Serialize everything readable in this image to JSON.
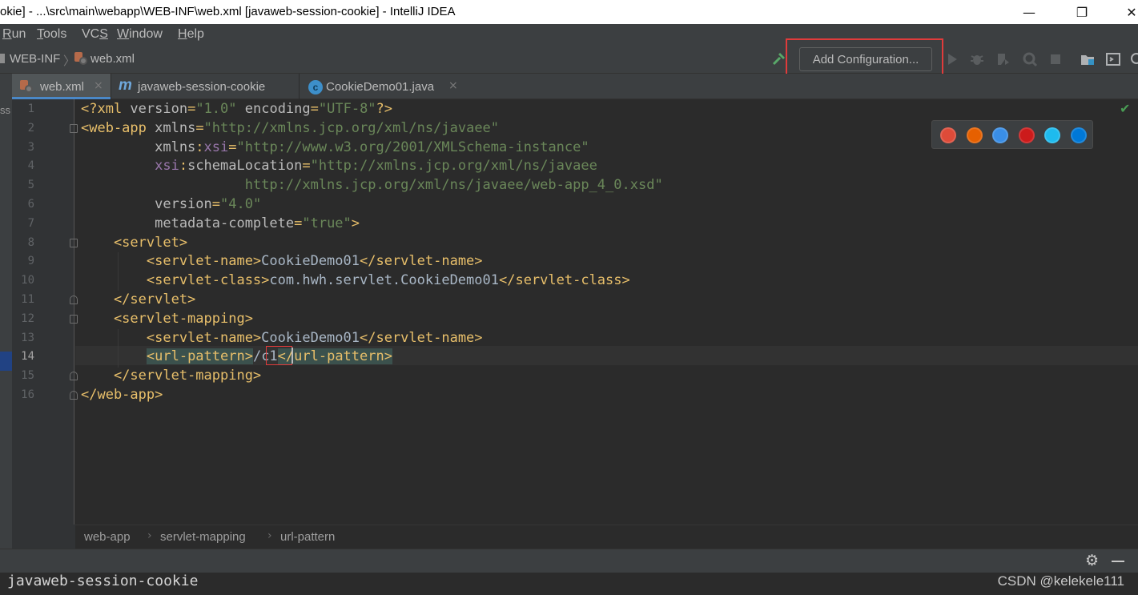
{
  "window": {
    "title": "okie] - ...\\src\\main\\webapp\\WEB-INF\\web.xml [javaweb-session-cookie] - IntelliJ IDEA",
    "minimize": "—",
    "maximize": "❐",
    "close": "✕"
  },
  "menu": {
    "items": [
      {
        "key": "R",
        "rest": "un"
      },
      {
        "key": "T",
        "rest": "ools"
      },
      {
        "key": "",
        "pre": "VC",
        "rest": "S"
      },
      {
        "key": "W",
        "rest": "indow"
      },
      {
        "key": "H",
        "rest": "elp"
      }
    ]
  },
  "nav": {
    "folder": "WEB-INF",
    "file": "web.xml",
    "add_configuration": "Add Configuration..."
  },
  "tabs": [
    {
      "label": "web.xml",
      "active": true,
      "icon": "xml-file-icon"
    },
    {
      "label": "javaweb-session-cookie",
      "active": false,
      "icon": "maven-m-icon"
    },
    {
      "label": "CookieDemo01.java",
      "active": false,
      "icon": "java-class-icon"
    }
  ],
  "tab_close": "×",
  "left_strip_text": "ss",
  "editor": {
    "line_numbers": [
      "1",
      "2",
      "3",
      "4",
      "5",
      "6",
      "7",
      "8",
      "9",
      "10",
      "11",
      "12",
      "13",
      "14",
      "15",
      "16"
    ],
    "current_line": 14,
    "lines": [
      [
        [
          "t-tag",
          "<?xml "
        ],
        [
          "t-attr",
          "version"
        ],
        [
          "t-tag",
          "="
        ],
        [
          "t-val",
          "\"1.0\""
        ],
        [
          "t-attr",
          " encoding"
        ],
        [
          "t-tag",
          "="
        ],
        [
          "t-val",
          "\"UTF-8\""
        ],
        [
          "t-tag",
          "?>"
        ]
      ],
      [
        [
          "t-tag",
          "<web-app "
        ],
        [
          "t-attr",
          "xmlns"
        ],
        [
          "t-tag",
          "="
        ],
        [
          "t-val",
          "\"http://xmlns.jcp.org/xml/ns/javaee\""
        ]
      ],
      [
        [
          "t-attr",
          "         xmlns"
        ],
        [
          "t-tag",
          ":"
        ],
        [
          "t-ns",
          "xsi"
        ],
        [
          "t-tag",
          "="
        ],
        [
          "t-val",
          "\"http://www.w3.org/2001/XMLSchema-instance\""
        ]
      ],
      [
        [
          "t-ns",
          "         xsi"
        ],
        [
          "t-tag",
          ":"
        ],
        [
          "t-attr",
          "schemaLocation"
        ],
        [
          "t-tag",
          "="
        ],
        [
          "t-val",
          "\"http://xmlns.jcp.org/xml/ns/javaee"
        ]
      ],
      [
        [
          "t-val",
          "                    http://xmlns.jcp.org/xml/ns/javaee/web-app_4_0.xsd\""
        ]
      ],
      [
        [
          "t-attr",
          "         version"
        ],
        [
          "t-tag",
          "="
        ],
        [
          "t-val",
          "\"4.0\""
        ]
      ],
      [
        [
          "t-attr",
          "         metadata-complete"
        ],
        [
          "t-tag",
          "="
        ],
        [
          "t-val",
          "\"true\""
        ],
        [
          "t-tag",
          ">"
        ]
      ],
      [
        [
          "t-tag",
          "    <servlet>"
        ]
      ],
      [
        [
          "t-tag",
          "        <servlet-name>"
        ],
        [
          "t-txt",
          "CookieDemo01"
        ],
        [
          "t-tag",
          "</servlet-name>"
        ]
      ],
      [
        [
          "t-tag",
          "        <servlet-class>"
        ],
        [
          "t-txt",
          "com.hwh.servlet.CookieDemo01"
        ],
        [
          "t-tag",
          "</servlet-class>"
        ]
      ],
      [
        [
          "t-tag",
          "    </servlet>"
        ]
      ],
      [
        [
          "t-tag",
          "    <servlet-mapping>"
        ]
      ],
      [
        [
          "t-tag",
          "        <servlet-name>"
        ],
        [
          "t-txt",
          "CookieDemo01"
        ],
        [
          "t-tag",
          "</servlet-name>"
        ]
      ],
      [
        [
          "t-txt",
          "        "
        ],
        [
          "t-tag tag-hl",
          "<url-pattern>"
        ],
        [
          "t-txt",
          "/c1"
        ],
        [
          "t-tag tag-hl",
          "</url-pattern>"
        ]
      ],
      [
        [
          "t-tag",
          "    </servlet-mapping>"
        ]
      ],
      [
        [
          "t-tag",
          "</web-app>"
        ]
      ]
    ]
  },
  "browsers": [
    {
      "name": "chrome-icon",
      "color": "#dd4b39"
    },
    {
      "name": "firefox-icon",
      "color": "#e66000"
    },
    {
      "name": "safari-icon",
      "color": "#3a8ee6"
    },
    {
      "name": "opera-icon",
      "color": "#cc1b1b"
    },
    {
      "name": "ie-icon",
      "color": "#1ebbee"
    },
    {
      "name": "edge-icon",
      "color": "#0078d7"
    }
  ],
  "breadcrumb": [
    "web-app",
    "servlet-mapping",
    "url-pattern"
  ],
  "breadcrumb_sep": "›",
  "bottom": {
    "project": "javaweb-session-cookie",
    "watermark": "CSDN @kelekele111",
    "gear": "⚙"
  },
  "checkmark": "✔"
}
